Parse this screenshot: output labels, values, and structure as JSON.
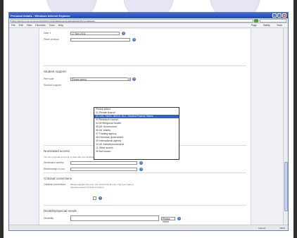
{
  "window": {
    "title": "Personal details - Windows Internet Explorer",
    "address": "https://apply1.ucas.com/example/2012/en/candidate/personal/details/editPersonalDetails",
    "menu": [
      "File",
      "Edit",
      "View",
      "Favorites",
      "Tools",
      "Help"
    ],
    "toolbar": [
      "Page",
      "Safety",
      "Tools"
    ]
  },
  "form": {
    "date_label": "Date 1",
    "date_value": "17 Nov 2011",
    "place_label": "Place of issue",
    "student_support": {
      "title": "Student support",
      "fee_code_label": "Fee code",
      "fee_code_value": "Please select",
      "student_support_label": "Student support",
      "options": [
        "Please select",
        "01 Private finance",
        "02 LEA, SAAS, NIELB, SLC, Student Finance Wales",
        "03 Research council",
        "04 DH/Regional Health",
        "05 UK Government",
        "06 UK charity",
        "07 Training agency",
        "08 Overseas government",
        "09 International agency",
        "10 UK industry/commerce",
        "11 Other source",
        "99 Not known"
      ]
    },
    "nominated": {
      "title": "Nominated access",
      "text": "You can nominate someone to deal with your application if you are away or need support.",
      "name_label": "Nominated access",
      "rel_label": "Relationship to you"
    },
    "criminal": {
      "title": "Criminal convictions",
      "text": "Please read the help text. You should tick the box only if you have a relevant unspent criminal conviction.",
      "label": "Criminal convictions"
    },
    "disability": {
      "title": "Disability/special needs",
      "label": "Disability",
      "value": "Please select"
    }
  },
  "status": {
    "zone": "Internet",
    "zoom": "100%"
  }
}
